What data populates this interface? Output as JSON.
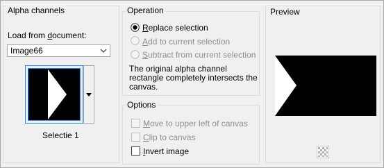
{
  "alpha": {
    "title": "Alpha channels",
    "load_label_pre": "Load from ",
    "load_label_u": "d",
    "load_label_post": "ocument:",
    "document_value": "Image66",
    "channel_name": "Selectie 1"
  },
  "operation": {
    "title": "Operation",
    "options": [
      {
        "pre": "",
        "u": "R",
        "post": "eplace selection",
        "selected": true,
        "enabled": true
      },
      {
        "pre": "",
        "u": "A",
        "post": "dd to current selection",
        "selected": false,
        "enabled": false
      },
      {
        "pre": "",
        "u": "S",
        "post": "ubtract from current selection",
        "selected": false,
        "enabled": false
      }
    ],
    "description": "The original alpha channel rectangle completely intersects the canvas."
  },
  "options": {
    "title": "Options",
    "move_pre": "",
    "move_u": "M",
    "move_post": "ove to upper left of canvas",
    "clip_pre": "",
    "clip_u": "C",
    "clip_post": "lip to canvas",
    "invert_pre": "",
    "invert_u": "I",
    "invert_post": "nvert image"
  },
  "preview": {
    "title": "Preview"
  },
  "colors": {
    "accent": "#1e90ff",
    "disabled": "#8d8d8d"
  }
}
